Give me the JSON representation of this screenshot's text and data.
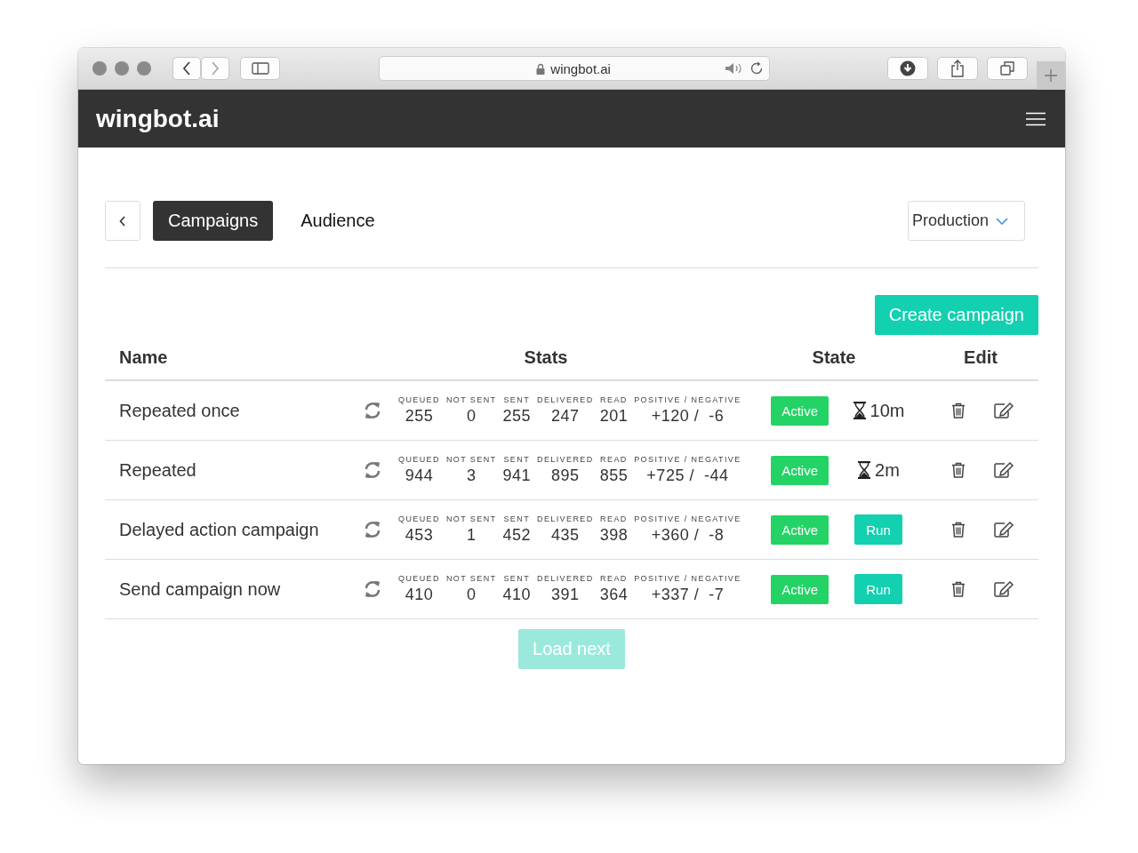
{
  "browser": {
    "url": "wingbot.ai"
  },
  "app": {
    "brand": "wingbot.ai"
  },
  "tabs": [
    {
      "label": "Campaigns",
      "selected": true
    },
    {
      "label": "Audience",
      "selected": false
    }
  ],
  "environment": {
    "value": "Production"
  },
  "create_button": "Create campaign",
  "table": {
    "columns": [
      "Name",
      "Stats",
      "State",
      "Edit"
    ],
    "rows": [
      {
        "name": "Repeated once",
        "stat_labels": [
          "QUEUED",
          "NOT SENT",
          "SENT",
          "DELIVERED",
          "READ",
          "POSITIVE / NEGATIVE"
        ],
        "stat_values": [
          "255",
          "0",
          "255",
          "247",
          "201",
          "+120 /  -6"
        ],
        "state": "Active",
        "action": {
          "kind": "timer",
          "label": "10m"
        }
      },
      {
        "name": "Repeated",
        "stat_labels": [
          "QUEUED",
          "NOT SENT",
          "SENT",
          "DELIVERED",
          "READ",
          "POSITIVE / NEGATIVE"
        ],
        "stat_values": [
          "944",
          "3",
          "941",
          "895",
          "855",
          "+725 /  -44"
        ],
        "state": "Active",
        "action": {
          "kind": "timer",
          "label": "2m"
        }
      },
      {
        "name": "Delayed action campaign",
        "stat_labels": [
          "QUEUED",
          "NOT SENT",
          "SENT",
          "DELIVERED",
          "READ",
          "POSITIVE / NEGATIVE"
        ],
        "stat_values": [
          "453",
          "1",
          "452",
          "435",
          "398",
          "+360 /  -8"
        ],
        "state": "Active",
        "action": {
          "kind": "run",
          "label": "Run"
        }
      },
      {
        "name": "Send campaign now",
        "stat_labels": [
          "QUEUED",
          "NOT SENT",
          "SENT",
          "DELIVERED",
          "READ",
          "POSITIVE / NEGATIVE"
        ],
        "stat_values": [
          "410",
          "0",
          "410",
          "391",
          "364",
          "+337 /  -7"
        ],
        "state": "Active",
        "action": {
          "kind": "run",
          "label": "Run"
        }
      }
    ]
  },
  "load_next": {
    "label": "Load next",
    "disabled": true
  }
}
